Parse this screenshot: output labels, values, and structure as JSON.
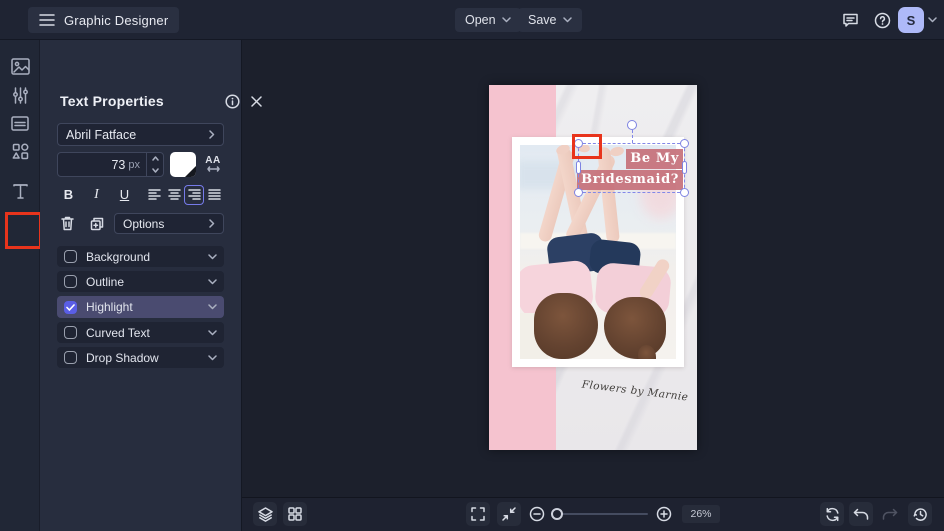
{
  "topbar": {
    "app_title": "Graphic Designer",
    "open_label": "Open",
    "save_label": "Save",
    "avatar_initial": "S"
  },
  "rail": {
    "tools": [
      "images",
      "adjustments",
      "layout",
      "shapes",
      "text"
    ],
    "active_tool": "text"
  },
  "panel": {
    "title": "Text Properties",
    "font_name": "Abril Fatface",
    "font_size": "73",
    "font_size_unit": "px",
    "style_buttons": [
      "B",
      "I",
      "U"
    ],
    "letter_spacing_label": "AA",
    "options_label": "Options",
    "align_selected": 2,
    "toggles": [
      {
        "label": "Background",
        "checked": false
      },
      {
        "label": "Outline",
        "checked": false
      },
      {
        "label": "Highlight",
        "checked": true
      },
      {
        "label": "Curved Text",
        "checked": false
      },
      {
        "label": "Drop Shadow",
        "checked": false
      }
    ]
  },
  "canvas": {
    "headline_line1": "Be My",
    "headline_line2": "Bridesmaid?",
    "caption": "Flowers by Marnie",
    "colors": {
      "pink_panel": "#f5c3cf",
      "marble": "#edecee",
      "text_highlight": "#c6707a",
      "selection": "#8287e8",
      "annotation_red": "#e8341c"
    }
  },
  "bottombar": {
    "zoom_value": "26%",
    "redo_enabled": false
  }
}
